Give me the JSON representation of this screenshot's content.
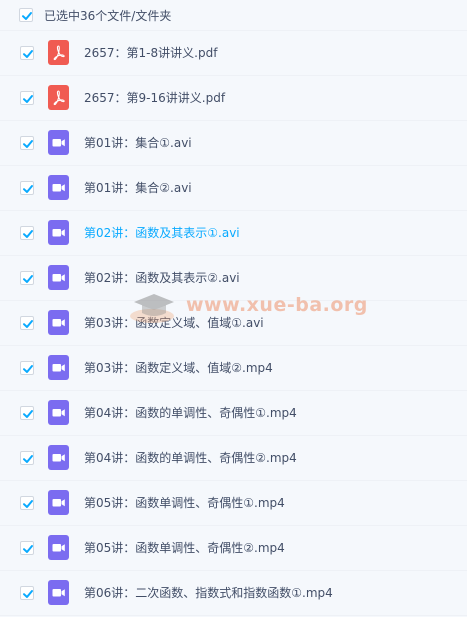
{
  "header": {
    "selection_text": "已选中36个文件/文件夹"
  },
  "colors": {
    "checkbox": "#09aaff",
    "pdf_icon": "#f05b52",
    "video_icon": "#7b6cf0",
    "highlight_text": "#09aaff"
  },
  "files": [
    {
      "name": "2657：第1-8讲讲义.pdf",
      "type": "pdf",
      "icon": "pdf-icon",
      "checked": true
    },
    {
      "name": "2657：第9-16讲讲义.pdf",
      "type": "pdf",
      "icon": "pdf-icon",
      "checked": true
    },
    {
      "name": "第01讲：集合①.avi",
      "type": "video",
      "icon": "video-icon",
      "checked": true
    },
    {
      "name": "第01讲：集合②.avi",
      "type": "video",
      "icon": "video-icon",
      "checked": true
    },
    {
      "name": "第02讲：函数及其表示①.avi",
      "type": "video",
      "icon": "video-icon",
      "checked": true,
      "highlighted": true
    },
    {
      "name": "第02讲：函数及其表示②.avi",
      "type": "video",
      "icon": "video-icon",
      "checked": true
    },
    {
      "name": "第03讲：函数定义域、值域①.avi",
      "type": "video",
      "icon": "video-icon",
      "checked": true
    },
    {
      "name": "第03讲：函数定义域、值域②.mp4",
      "type": "video",
      "icon": "video-icon",
      "checked": true
    },
    {
      "name": "第04讲：函数的单调性、奇偶性①.mp4",
      "type": "video",
      "icon": "video-icon",
      "checked": true
    },
    {
      "name": "第04讲：函数的单调性、奇偶性②.mp4",
      "type": "video",
      "icon": "video-icon",
      "checked": true
    },
    {
      "name": "第05讲：函数单调性、奇偶性①.mp4",
      "type": "video",
      "icon": "video-icon",
      "checked": true
    },
    {
      "name": "第05讲：函数单调性、奇偶性②.mp4",
      "type": "video",
      "icon": "video-icon",
      "checked": true
    },
    {
      "name": "第06讲：二次函数、指数式和指数函数①.mp4",
      "type": "video",
      "icon": "video-icon",
      "checked": true
    }
  ],
  "watermark": {
    "text": "www.xue-ba.org",
    "icon": "graduation-cap-icon"
  }
}
